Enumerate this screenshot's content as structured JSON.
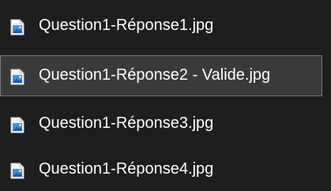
{
  "files": [
    {
      "name": "Question1-Réponse1.jpg",
      "icon": "image-file-icon"
    },
    {
      "name": "Question1-Réponse2 - Valide.jpg",
      "icon": "image-file-icon",
      "selected": true
    },
    {
      "name": "Question1-Réponse3.jpg",
      "icon": "image-file-icon"
    },
    {
      "name": "Question1-Réponse4.jpg",
      "icon": "image-file-icon"
    }
  ],
  "colors": {
    "background": "#1e1e1e",
    "selection_background": "#3a3a3a",
    "selection_border": "#7a7a7a",
    "text": "#ffffff",
    "icon_blue": "#3d8fe0"
  }
}
